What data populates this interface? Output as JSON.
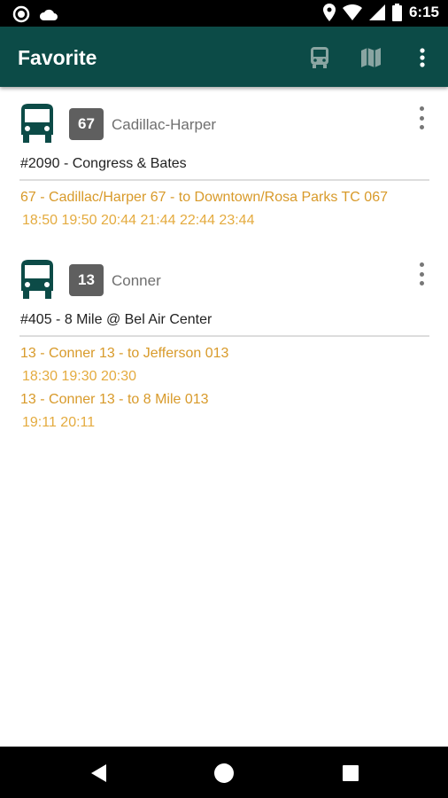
{
  "status_bar": {
    "time": "6:15"
  },
  "app_bar": {
    "title": "Favorite",
    "actions": [
      "bus-icon",
      "map-icon",
      "more-vert-icon"
    ]
  },
  "favorites": [
    {
      "route_number": "67",
      "route_name": "Cadillac-Harper",
      "stop": "#2090 - Congress & Bates",
      "directions": [
        {
          "label": "67 - Cadillac/Harper 67 - to Downtown/Rosa Parks TC 067",
          "times": "18:50  19:50  20:44  21:44  22:44  23:44"
        }
      ]
    },
    {
      "route_number": "13",
      "route_name": "Conner",
      "stop": "#405 - 8 Mile @ Bel Air Center",
      "directions": [
        {
          "label": "13 - Conner 13 - to Jefferson 013",
          "times": "18:30  19:30  20:30"
        },
        {
          "label": "13 - Conner 13 - to 8 Mile 013",
          "times": "19:11  20:11"
        }
      ]
    }
  ],
  "colors": {
    "app_bar": "#0c4b47",
    "bus_icon": "#0c4b47",
    "badge": "#5f5f5f",
    "direction_text": "#d89a2a",
    "times_text": "#e4ab3f"
  },
  "nav_bar": {
    "buttons": [
      "back-icon",
      "home-icon",
      "recents-icon"
    ]
  }
}
